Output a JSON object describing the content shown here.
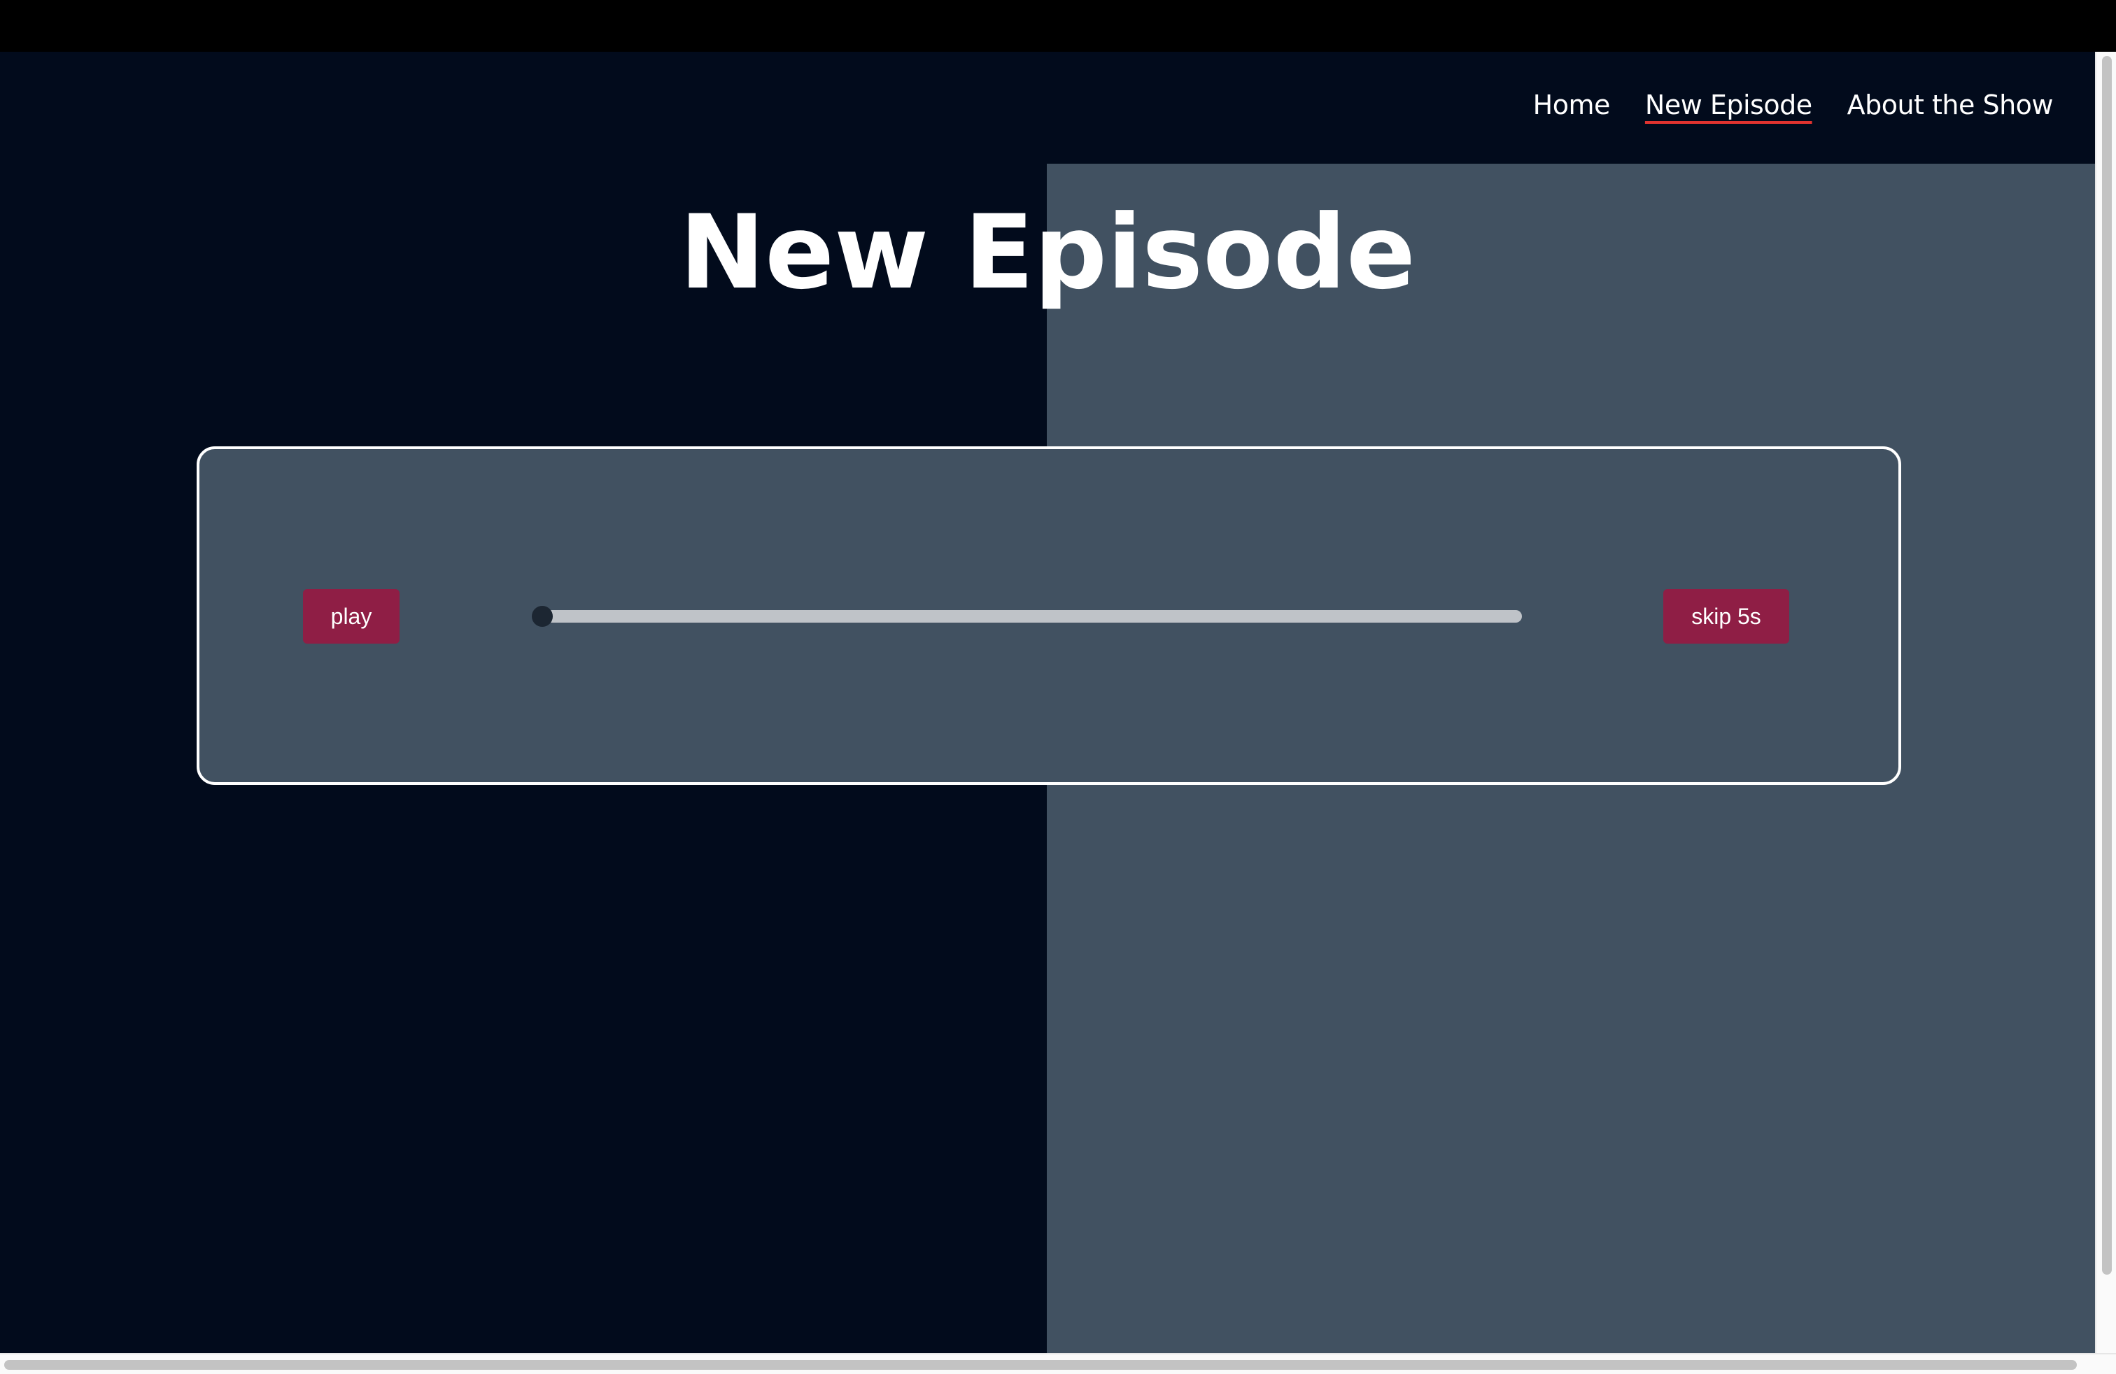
{
  "nav": {
    "items": [
      {
        "label": "Home",
        "active": false
      },
      {
        "label": "New Episode",
        "active": true
      },
      {
        "label": "About the Show",
        "active": false
      }
    ]
  },
  "page": {
    "title": "New Episode"
  },
  "player": {
    "play_label": "play",
    "skip_label": "skip 5s",
    "progress": 0
  },
  "colors": {
    "background": "#020b1c",
    "panel": "#415161",
    "button": "#8f1e45",
    "active_underline": "#e0332f"
  }
}
